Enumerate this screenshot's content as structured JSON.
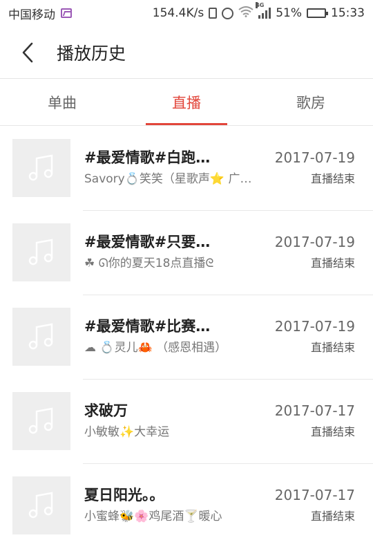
{
  "status_bar": {
    "carrier": "中国移动",
    "speed": "154.4K/s",
    "network": "4G",
    "battery": "51%",
    "battery_level": 0.51,
    "time": "15:33"
  },
  "header": {
    "title": "播放历史"
  },
  "tabs": [
    {
      "label": "单曲",
      "active": false
    },
    {
      "label": "直播",
      "active": true
    },
    {
      "label": "歌房",
      "active": false
    }
  ],
  "colors": {
    "accent": "#e2463b",
    "thumb_bg": "#eeeeee"
  },
  "items": [
    {
      "title": "#最爱情歌#白跑…",
      "subtitle": "Savory💍笑笑（星歌声⭐ 广…",
      "date": "2017-07-19",
      "status": "直播结束",
      "icon": "music-note-icon"
    },
    {
      "title": "#最爱情歌#只要…",
      "subtitle": "☘ ᘏ你的夏天18点直播ᘓ",
      "date": "2017-07-19",
      "status": "直播结束",
      "icon": "music-note-icon"
    },
    {
      "title": "#最爱情歌#比赛…",
      "subtitle": "☁ 💍灵儿🦀 （感恩相遇）",
      "date": "2017-07-19",
      "status": "直播结束",
      "icon": "music-note-icon"
    },
    {
      "title": "求破万",
      "subtitle": "小敏敏✨大幸运",
      "date": "2017-07-17",
      "status": "直播结束",
      "icon": "music-note-icon"
    },
    {
      "title": "夏日阳光。。",
      "subtitle": "小蜜蜂🐝🌸鸡尾酒🍸暖心",
      "date": "2017-07-17",
      "status": "直播结束",
      "icon": "music-note-icon"
    }
  ]
}
